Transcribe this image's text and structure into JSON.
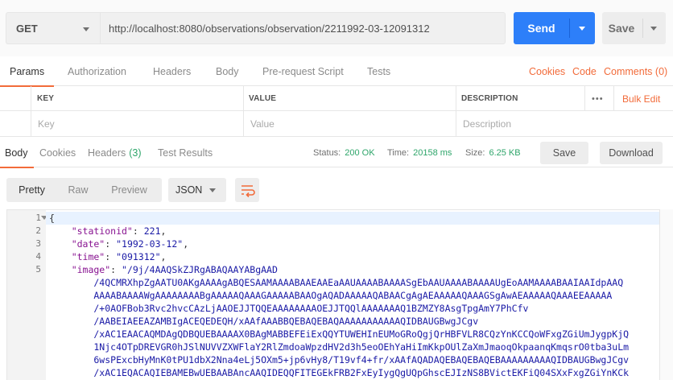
{
  "request": {
    "method": "GET",
    "url": "http://localhost:8080/observations/observation/2211992-03-12091312",
    "send_label": "Send",
    "save_label": "Save"
  },
  "request_tabs": [
    "Params",
    "Authorization",
    "Headers",
    "Body",
    "Pre-request Script",
    "Tests"
  ],
  "request_links": {
    "cookies": "Cookies",
    "code": "Code",
    "comments": "Comments (0)"
  },
  "params_table": {
    "headers": {
      "key": "KEY",
      "value": "VALUE",
      "description": "DESCRIPTION",
      "more": "•••",
      "bulk_edit": "Bulk Edit"
    },
    "placeholders": {
      "key": "Key",
      "value": "Value",
      "description": "Description"
    }
  },
  "response_tabs": {
    "body": "Body",
    "cookies": "Cookies",
    "headers": "Headers",
    "headers_count": "(3)",
    "test_results": "Test Results"
  },
  "response_meta": {
    "status_label": "Status:",
    "status_value": "200 OK",
    "time_label": "Time:",
    "time_value": "20158 ms",
    "size_label": "Size:",
    "size_value": "6.25 KB",
    "save_label": "Save",
    "download_label": "Download"
  },
  "view_modes": {
    "pretty": "Pretty",
    "raw": "Raw",
    "preview": "Preview",
    "format": "JSON"
  },
  "body_lines": [
    {
      "num": "1",
      "parts": [
        {
          "t": "{",
          "c": "p"
        }
      ]
    },
    {
      "num": "2",
      "parts": [
        {
          "t": "    \"stationid\"",
          "c": "key"
        },
        {
          "t": ": ",
          "c": "p"
        },
        {
          "t": "221",
          "c": "str"
        },
        {
          "t": ",",
          "c": "p"
        }
      ]
    },
    {
      "num": "3",
      "parts": [
        {
          "t": "    \"date\"",
          "c": "key"
        },
        {
          "t": ": ",
          "c": "p"
        },
        {
          "t": "\"1992-03-12\"",
          "c": "str"
        },
        {
          "t": ",",
          "c": "p"
        }
      ]
    },
    {
      "num": "4",
      "parts": [
        {
          "t": "    \"time\"",
          "c": "key"
        },
        {
          "t": ": ",
          "c": "p"
        },
        {
          "t": "\"091312\"",
          "c": "str"
        },
        {
          "t": ",",
          "c": "p"
        }
      ]
    },
    {
      "num": "5",
      "parts": [
        {
          "t": "    \"image\"",
          "c": "key"
        },
        {
          "t": ": ",
          "c": "p"
        },
        {
          "t": "\"/9j/4AAQSkZJRgABAQAAYABgAAD",
          "c": "str"
        }
      ]
    },
    {
      "num": "",
      "parts": [
        {
          "t": "        /4QCMRXhpZgAATU0AKgAAAAgABQESAAMAAAABAAEAAEaAAUAAAABAAAASgEbAAUAAAABAAAAUgEoAAMAAAABAAIAAIdpAAQ",
          "c": "str"
        }
      ]
    },
    {
      "num": "",
      "parts": [
        {
          "t": "        AAAABAAAAWgAAAAAAAABgAAAAAQAAAGAAAAABAAOgAQADAAAAAQABAACgAgAEAAAAAQAAAGSgAwAEAAAAAQAAAEEAAAAA",
          "c": "str"
        }
      ]
    },
    {
      "num": "",
      "parts": [
        {
          "t": "        /+0AOFBob3Rvc2hvcCAzLjAAOEJJTQQEAAAAAAAAOEJJTQQlAAAAAAAQ1BZMZY8AsgTpgAmY7PhCfv",
          "c": "str"
        }
      ]
    },
    {
      "num": "",
      "parts": [
        {
          "t": "        /AABEIAEEAZAMBIgACEQEDEQH/xAAfAAABBQEBAQEBAQAAAAAAAAAAAQIDBAUGBwgJCgv",
          "c": "str"
        }
      ]
    },
    {
      "num": "",
      "parts": [
        {
          "t": "        /xAC1EAACAQMDAgQDBQUEBAAAAX0BAgMABBEFEiExQQYTUWEHInEUMoGRoQgjQrHBFVLR8CQzYnKCCQoWFxgZGiUmJygpKjQ",
          "c": "str"
        }
      ]
    },
    {
      "num": "",
      "parts": [
        {
          "t": "        1Njc4OTpDREVGR0hJSlNUVVZXWFlaY2RlZmdoaWpzdHV2d3h5eoOEhYaHiImKkpOUlZaXmJmaoqOkpaanqKmqsrO0tba3uLm",
          "c": "str"
        }
      ]
    },
    {
      "num": "",
      "parts": [
        {
          "t": "        6wsPExcbHyMnK0tPU1dbX2Nna4eLj5OXm5+jp6vHy8/T19vf4+fr/xAAfAQADAQEBAQEBAQEBAAAAAAAAAQIDBAUGBwgJCgv",
          "c": "str"
        }
      ]
    },
    {
      "num": "",
      "parts": [
        {
          "t": "        /xAC1EQACAQIEBAMEBwUEBAABAncAAQIDEQQFITEGEkFRB2FxEyIygQgUQpGhscEJIzNS8BVictEKFiQ04SXxFxgZGiYnKCk",
          "c": "str"
        }
      ]
    }
  ]
}
